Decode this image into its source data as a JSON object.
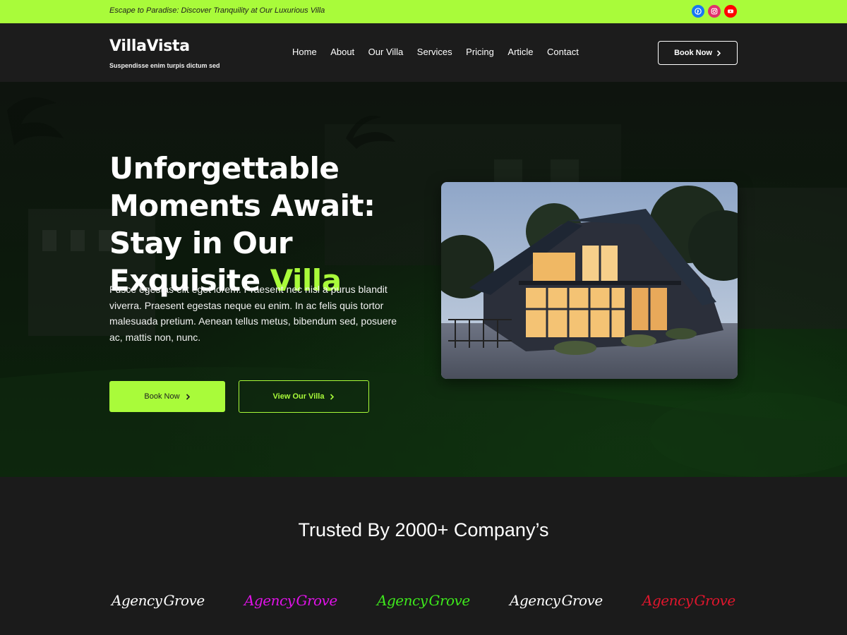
{
  "topbar": {
    "tagline": "Escape to Paradise: Discover Tranquility at Our Luxurious Villa",
    "socials": [
      {
        "name": "facebook-icon",
        "color": "#1877f2"
      },
      {
        "name": "instagram-icon",
        "color": "#e1306c"
      },
      {
        "name": "youtube-icon",
        "color": "#ff0000"
      }
    ]
  },
  "header": {
    "brand": "VillaVista",
    "brand_sub": "Suspendisse enim turpis dictum sed",
    "nav": [
      "Home",
      "About",
      "Our Villa",
      "Services",
      "Pricing",
      "Article",
      "Contact"
    ],
    "cta": "Book Now"
  },
  "hero": {
    "title_part1": "Unforgettable Moments Await: Stay in Our Exquisite ",
    "title_highlight": "Villa",
    "description": "Fusce egestas elit eget lorem. Praesent nec nisl a purus blandit viverra. Praesent egestas neque eu enim. In ac felis quis tortor malesuada pretium. Aenean tellus metus, bibendum sed, posuere ac, mattis non, nunc.",
    "primary_button": "Book Now",
    "secondary_button": "View Our Villa"
  },
  "trusted": {
    "heading": "Trusted By 2000+ Company’s",
    "logos": [
      {
        "left": "Agency",
        "right": "Grove",
        "color": "#ffffff"
      },
      {
        "left": "Agency",
        "right": "Grove",
        "color": "#e012e8"
      },
      {
        "left": "Agency",
        "right": "Grove",
        "color": "#3ee81c"
      },
      {
        "left": "Agency",
        "right": "Grove",
        "color": "#ffffff"
      },
      {
        "left": "Agency",
        "right": "Grove",
        "color": "#e0162d"
      }
    ]
  },
  "colors": {
    "accent": "#a9fb3a",
    "dark": "#1b1b1b"
  }
}
